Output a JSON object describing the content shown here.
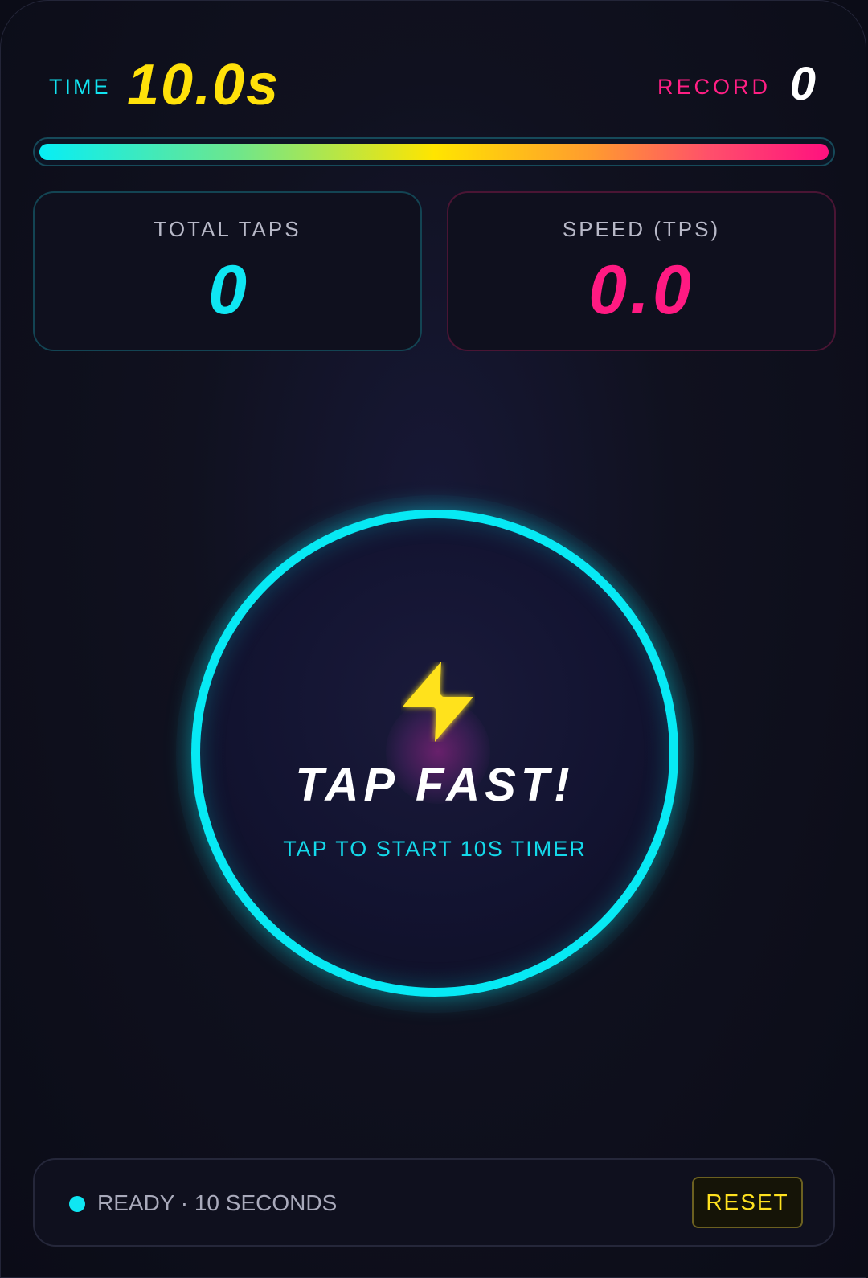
{
  "header": {
    "time_label": "TIME",
    "time_value": "10.0s",
    "record_label": "RECORD",
    "record_value": "0"
  },
  "timer_progress": {
    "fraction": 1.0
  },
  "stats": {
    "total_taps_label": "TOTAL TAPS",
    "total_taps_value": "0",
    "speed_label": "SPEED (TPS)",
    "speed_value": "0.0"
  },
  "tap_button": {
    "icon": "lightning-bolt-icon",
    "title": "TAP FAST!",
    "subtitle": "TAP TO START 10S TIMER"
  },
  "footer": {
    "status_text": "READY · 10 SECONDS",
    "reset_label": "RESET"
  },
  "colors": {
    "accent_cyan": "#07e9f4",
    "accent_pink": "#ff1a82",
    "accent_yellow": "#ffe10a",
    "background": "#0b0c17"
  }
}
